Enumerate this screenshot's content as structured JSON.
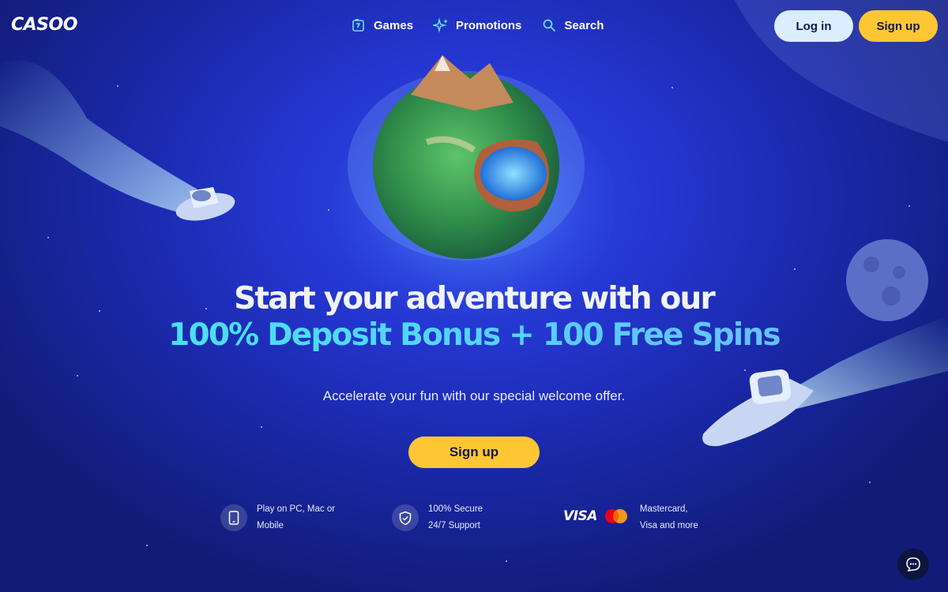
{
  "brand": {
    "logo_text": "CASOO"
  },
  "nav": {
    "items": [
      {
        "label": "Games",
        "icon": "slot-seven-icon"
      },
      {
        "label": "Promotions",
        "icon": "sparkle-icon"
      },
      {
        "label": "Search",
        "icon": "search-icon"
      }
    ]
  },
  "header": {
    "login_label": "Log in",
    "signup_label": "Sign up"
  },
  "hero": {
    "title_line1": "Start your adventure with our",
    "title_line2": "100% Deposit Bonus + 100 Free Spins",
    "subtitle": "Accelerate your fun with our special welcome offer.",
    "cta_label": "Sign up"
  },
  "features": [
    {
      "icon": "mobile-icon",
      "line1": "Play on PC, Mac or",
      "line2": "Mobile"
    },
    {
      "icon": "shield-check-icon",
      "line1": "100% Secure",
      "line2": "24/7 Support"
    },
    {
      "icon": "payment-cards-icon",
      "badge": "VISA",
      "line1": "Mastercard,",
      "line2": "Visa and more"
    }
  ],
  "chat": {
    "icon": "chat-bubble-icon"
  },
  "colors": {
    "background": "#2436cf",
    "accent_yellow": "#ffc634",
    "accent_cyan": "#42e8e6",
    "login_button": "#dbeeff"
  }
}
